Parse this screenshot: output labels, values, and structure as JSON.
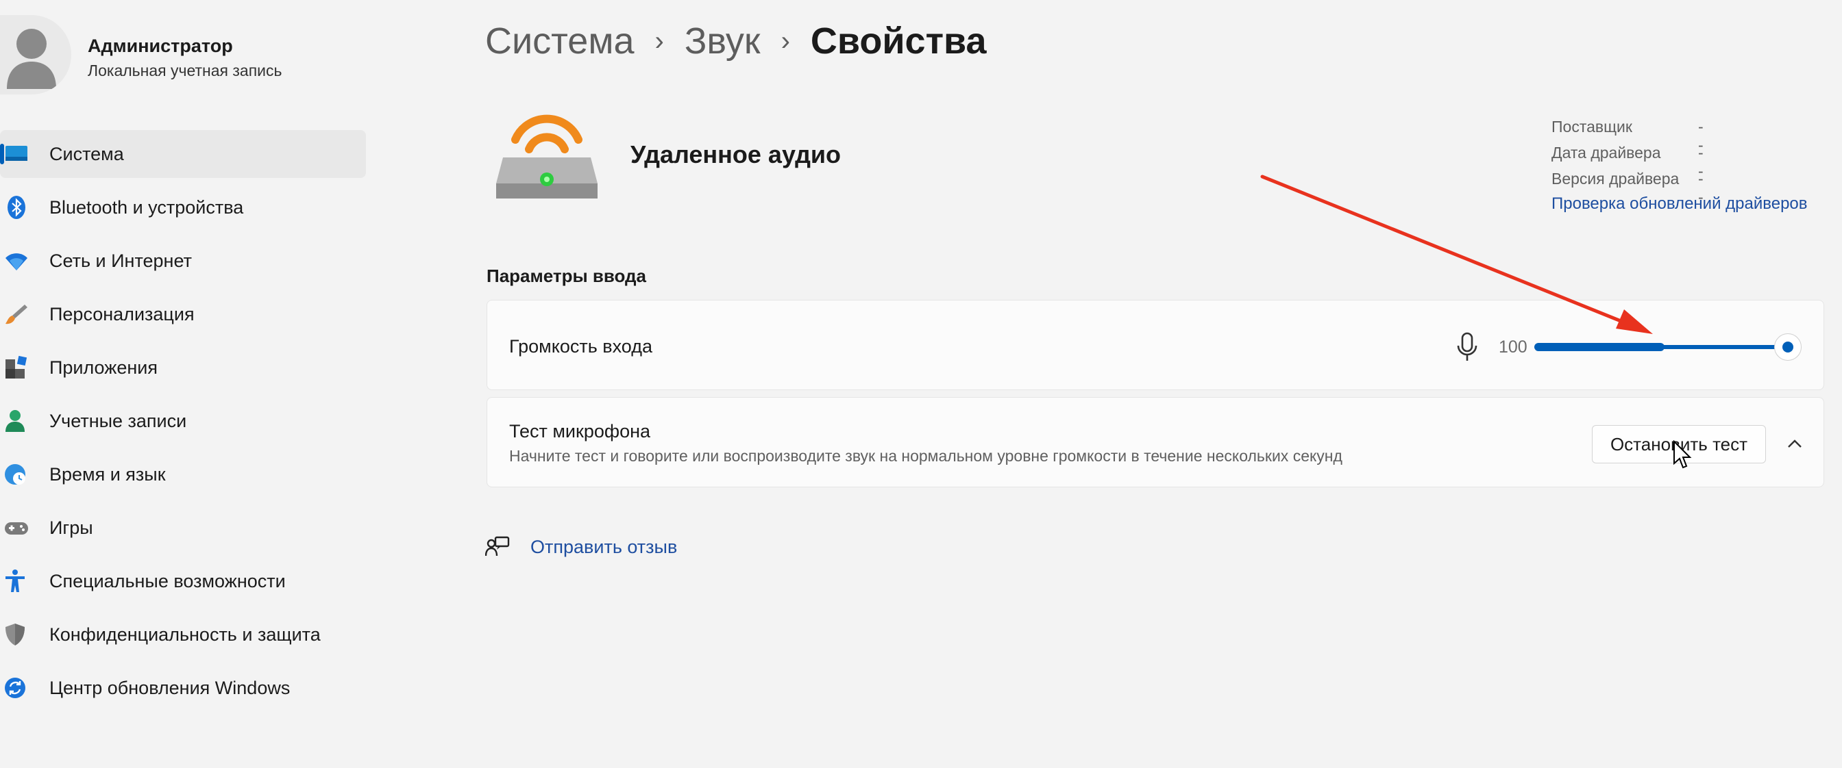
{
  "user": {
    "name": "Администратор",
    "account_type": "Локальная учетная запись"
  },
  "sidebar": {
    "items": [
      {
        "label": "Система",
        "icon": "monitor-icon",
        "active": true
      },
      {
        "label": "Bluetooth и устройства",
        "icon": "bluetooth-icon"
      },
      {
        "label": "Сеть и Интернет",
        "icon": "wifi-icon"
      },
      {
        "label": "Персонализация",
        "icon": "brush-icon"
      },
      {
        "label": "Приложения",
        "icon": "apps-icon"
      },
      {
        "label": "Учетные записи",
        "icon": "person-icon"
      },
      {
        "label": "Время и язык",
        "icon": "clock-globe-icon"
      },
      {
        "label": "Игры",
        "icon": "gamepad-icon"
      },
      {
        "label": "Специальные возможности",
        "icon": "accessibility-icon"
      },
      {
        "label": "Конфиденциальность и защита",
        "icon": "shield-icon"
      },
      {
        "label": "Центр обновления Windows",
        "icon": "update-icon"
      }
    ]
  },
  "breadcrumb": {
    "items": [
      "Система",
      "Звук",
      "Свойства"
    ],
    "separator": "›"
  },
  "device": {
    "name": "Удаленное аудио",
    "icon": "remote-audio-device-icon"
  },
  "properties": {
    "rows": [
      {
        "key": "Поставщик",
        "value": "--"
      },
      {
        "key": "Дата драйвера",
        "value": "--"
      },
      {
        "key": "Версия драйвера",
        "value": "--"
      }
    ],
    "update_link": "Проверка обновлений драйверов"
  },
  "input_settings": {
    "section_title": "Параметры ввода",
    "volume": {
      "label": "Громкость входа",
      "value": "100",
      "level_percent": 100
    },
    "mic_test": {
      "title": "Тест микрофона",
      "description": "Начните тест и говорите или воспроизводите звук на нормальном уровне громкости в течение нескольких секунд",
      "button_label": "Остановить тест"
    }
  },
  "feedback": {
    "label": "Отправить отзыв"
  },
  "colors": {
    "accent": "#005fb8",
    "link": "#1e4ea0",
    "annotation_arrow": "#e8321e"
  }
}
